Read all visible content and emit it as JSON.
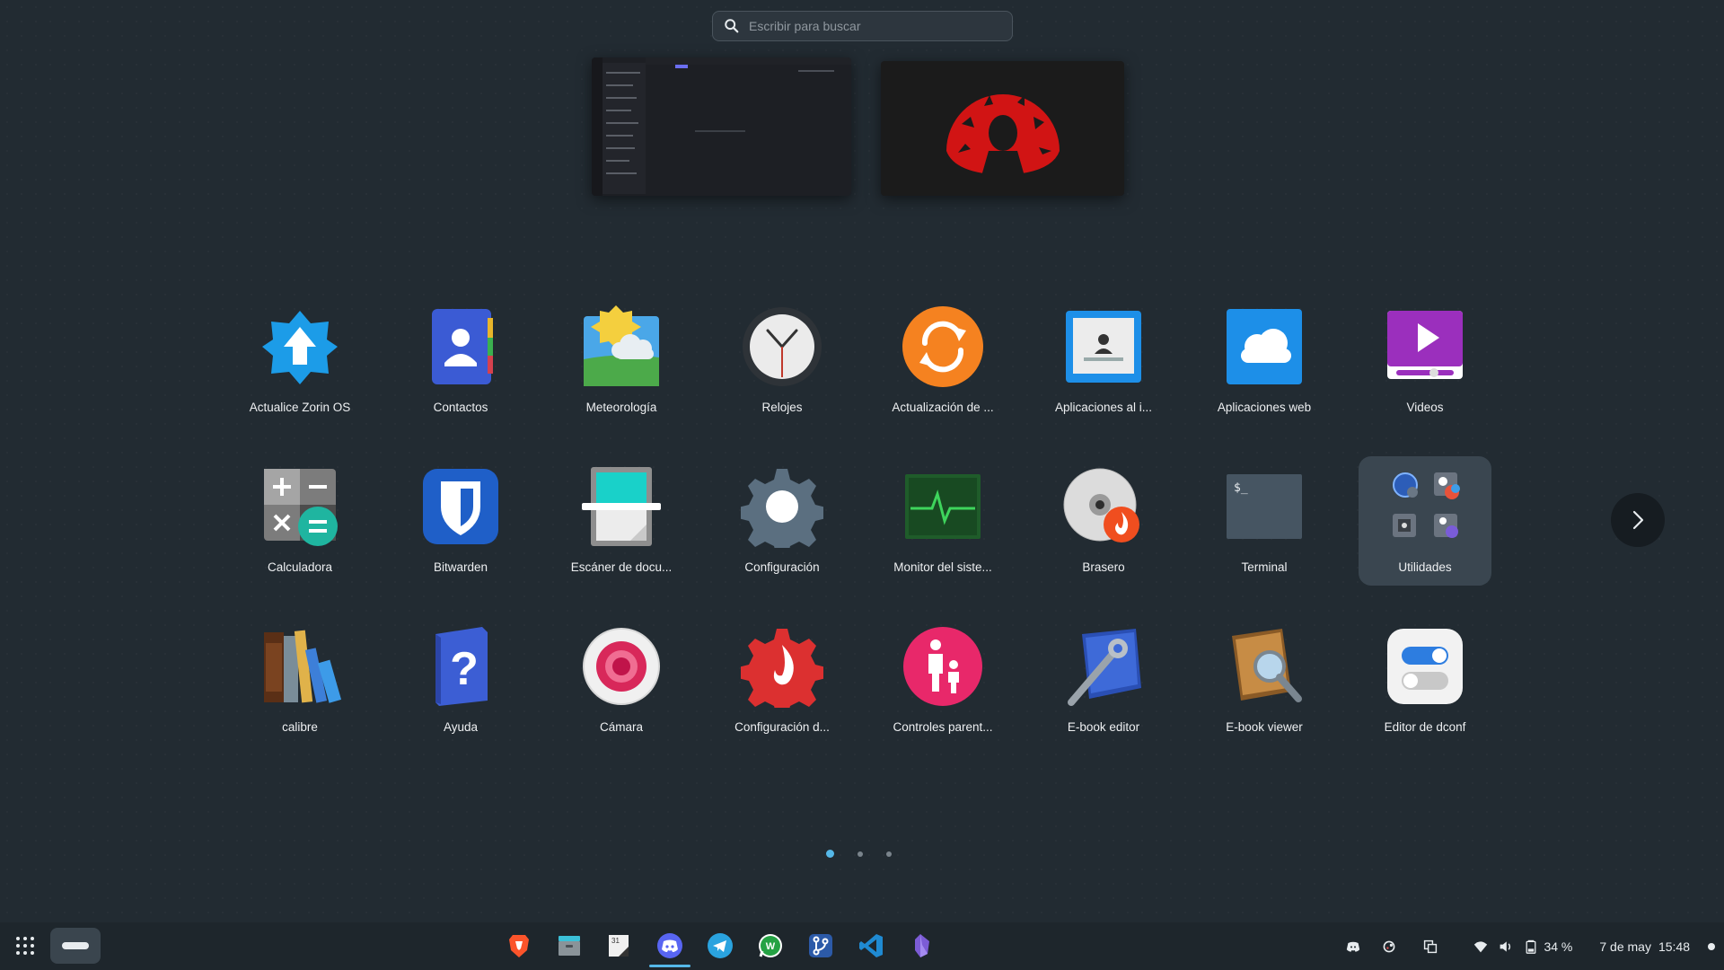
{
  "search": {
    "placeholder": "Escribir para buscar"
  },
  "apps": [
    {
      "label": "Actualice Zorin OS",
      "icon": "zorin-update-icon"
    },
    {
      "label": "Contactos",
      "icon": "contacts-icon"
    },
    {
      "label": "Meteorología",
      "icon": "weather-icon"
    },
    {
      "label": "Relojes",
      "icon": "clocks-icon"
    },
    {
      "label": "Actualización de ...",
      "icon": "software-update-icon"
    },
    {
      "label": "Aplicaciones al i...",
      "icon": "startup-apps-icon"
    },
    {
      "label": "Aplicaciones web",
      "icon": "web-apps-icon"
    },
    {
      "label": "Videos",
      "icon": "videos-icon"
    },
    {
      "label": "Calculadora",
      "icon": "calculator-icon"
    },
    {
      "label": "Bitwarden",
      "icon": "bitwarden-icon"
    },
    {
      "label": "Escáner de docu...",
      "icon": "document-scanner-icon"
    },
    {
      "label": "Configuración",
      "icon": "settings-icon"
    },
    {
      "label": "Monitor del siste...",
      "icon": "system-monitor-icon"
    },
    {
      "label": "Brasero",
      "icon": "brasero-icon"
    },
    {
      "label": "Terminal",
      "icon": "terminal-icon"
    },
    {
      "label": "Utilidades",
      "icon": "utilities-folder-icon"
    },
    {
      "label": "calibre",
      "icon": "calibre-icon"
    },
    {
      "label": "Ayuda",
      "icon": "help-icon"
    },
    {
      "label": "Cámara",
      "icon": "camera-icon"
    },
    {
      "label": "Configuración d...",
      "icon": "firewall-config-icon"
    },
    {
      "label": "Controles parent...",
      "icon": "parental-controls-icon"
    },
    {
      "label": "E-book editor",
      "icon": "ebook-editor-icon"
    },
    {
      "label": "E-book viewer",
      "icon": "ebook-viewer-icon"
    },
    {
      "label": "Editor de dconf",
      "icon": "dconf-editor-icon"
    }
  ],
  "pages": {
    "count": 3,
    "current": 1
  },
  "terminal_prompt": "$_",
  "taskbar": {
    "apps": [
      "brave-icon",
      "files-icon",
      "calendar-notes-icon",
      "discord-icon",
      "telegram-icon",
      "whatsapp-icon",
      "git-client-icon",
      "vscode-icon",
      "obsidian-icon"
    ],
    "running": "discord-icon",
    "battery": "34 %",
    "date": "7 de may",
    "time": "15:48"
  },
  "colors": {
    "accent": "#55b8e8",
    "background": "#222b32",
    "taskbar": "#1e262c"
  }
}
